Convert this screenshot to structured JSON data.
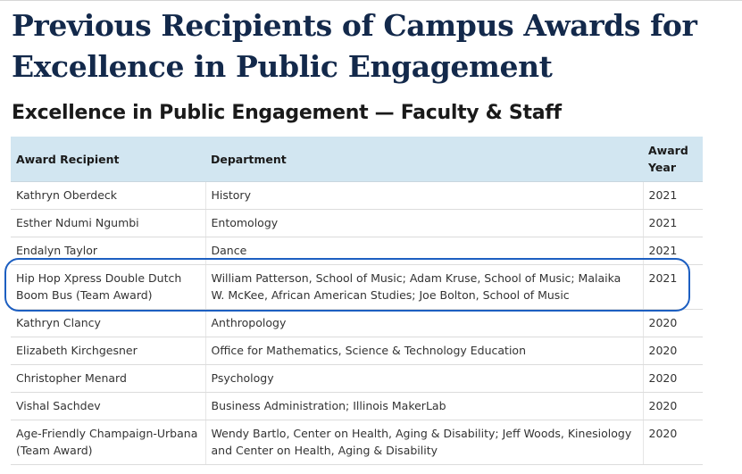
{
  "page": {
    "title": "Previous Recipients of Campus Awards for Excellence in Public Engagement",
    "section_heading": "Excellence in Public Engagement — Faculty & Staff"
  },
  "table": {
    "headers": {
      "recipient": "Award Recipient",
      "department": "Department",
      "year": "Award Year"
    },
    "rows": [
      {
        "recipient": "Kathryn Oberdeck",
        "department": "History",
        "year": "2021"
      },
      {
        "recipient": "Esther Ndumi Ngumbi",
        "department": "Entomology",
        "year": "2021"
      },
      {
        "recipient": "Endalyn Taylor",
        "department": "Dance",
        "year": "2021"
      },
      {
        "recipient": "Hip Hop Xpress Double Dutch Boom Bus (Team Award)",
        "department": "William Patterson, School of Music; Adam Kruse, School of Music; Malaika W. McKee, African American Studies; Joe Bolton, School of Music",
        "year": "2021"
      },
      {
        "recipient": "Kathryn Clancy",
        "department": "Anthropology",
        "year": "2020"
      },
      {
        "recipient": "Elizabeth Kirchgesner",
        "department": "Office for Mathematics, Science & Technology Education",
        "year": "2020"
      },
      {
        "recipient": "Christopher Menard",
        "department": "Psychology",
        "year": "2020"
      },
      {
        "recipient": "Vishal Sachdev",
        "department": "Business Administration; Illinois MakerLab",
        "year": "2020"
      },
      {
        "recipient": "Age-Friendly Champaign-Urbana (Team Award)",
        "department": "Wendy Bartlo, Center on Health, Aging & Disability; Jeff Woods, Kinesiology and Center on Health, Aging & Disability",
        "year": "2020"
      }
    ]
  },
  "colors": {
    "title": "#13294b",
    "header_bg": "#d2e6f1",
    "highlight_border": "#1d5fc1"
  }
}
